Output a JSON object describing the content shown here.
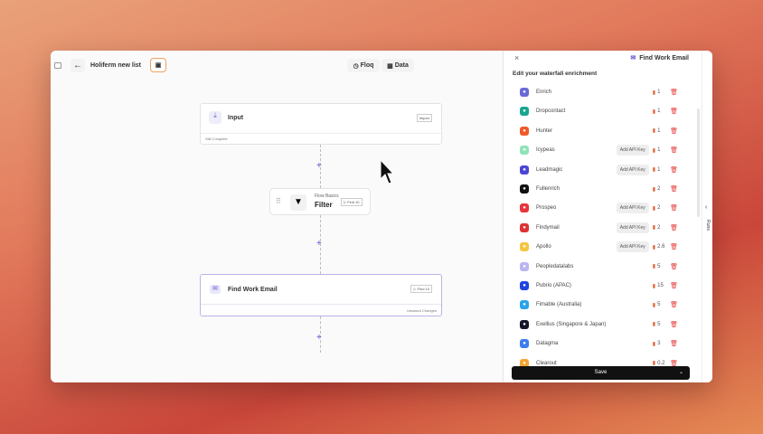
{
  "header": {
    "title": "Holiferm new list",
    "tabs": [
      {
        "label": "Floq"
      },
      {
        "label": "Data"
      }
    ]
  },
  "canvas": {
    "input_node": {
      "title": "Input",
      "action": "Import",
      "status": "Still Complete"
    },
    "filter_node": {
      "subtitle": "Flow Basics",
      "title": "Filter",
      "action": "Find 10"
    },
    "email_node": {
      "title": "Find Work Email",
      "action": "Find 10",
      "status": "Unsaved Changes"
    }
  },
  "panel": {
    "title": "Find Work Email",
    "heading": "Edit your waterfall enrichment",
    "save_label": "Save",
    "side_tab": "Runs",
    "providers": [
      {
        "name": "Enrich",
        "cost": "1",
        "api": null,
        "color": "#6b6bd6"
      },
      {
        "name": "Dropcontact",
        "cost": "1",
        "api": null,
        "color": "#1aa58f"
      },
      {
        "name": "Hunter",
        "cost": "1",
        "api": null,
        "color": "#f2592a"
      },
      {
        "name": "Icypeas",
        "cost": "1",
        "api": "Add API Key",
        "color": "#8fe3b8"
      },
      {
        "name": "Leadmagic",
        "cost": "1",
        "api": "Add API Key",
        "color": "#4b45d6"
      },
      {
        "name": "Fullenrich",
        "cost": "2",
        "api": null,
        "color": "#111111"
      },
      {
        "name": "Prospeo",
        "cost": "2",
        "api": "Add API Key",
        "color": "#e8343c"
      },
      {
        "name": "Findymail",
        "cost": "2",
        "api": "Add API Key",
        "color": "#d33"
      },
      {
        "name": "Apollo",
        "cost": "2.6",
        "api": "Add API Key",
        "color": "#f5c542"
      },
      {
        "name": "Peopledatalabs",
        "cost": "5",
        "api": null,
        "color": "#b9b6f0"
      },
      {
        "name": "Pubrio (APAC)",
        "cost": "15",
        "api": null,
        "color": "#1f45e0"
      },
      {
        "name": "Fimable (Australia)",
        "cost": "5",
        "api": null,
        "color": "#2aa5e8"
      },
      {
        "name": "Exellius (Singapore & Japan)",
        "cost": "5",
        "api": null,
        "color": "#15152b"
      },
      {
        "name": "Datagma",
        "cost": "3",
        "api": null,
        "color": "#3d7cf0"
      },
      {
        "name": "Clearout",
        "cost": "0.2",
        "api": null,
        "color": "#f6a531"
      }
    ]
  }
}
